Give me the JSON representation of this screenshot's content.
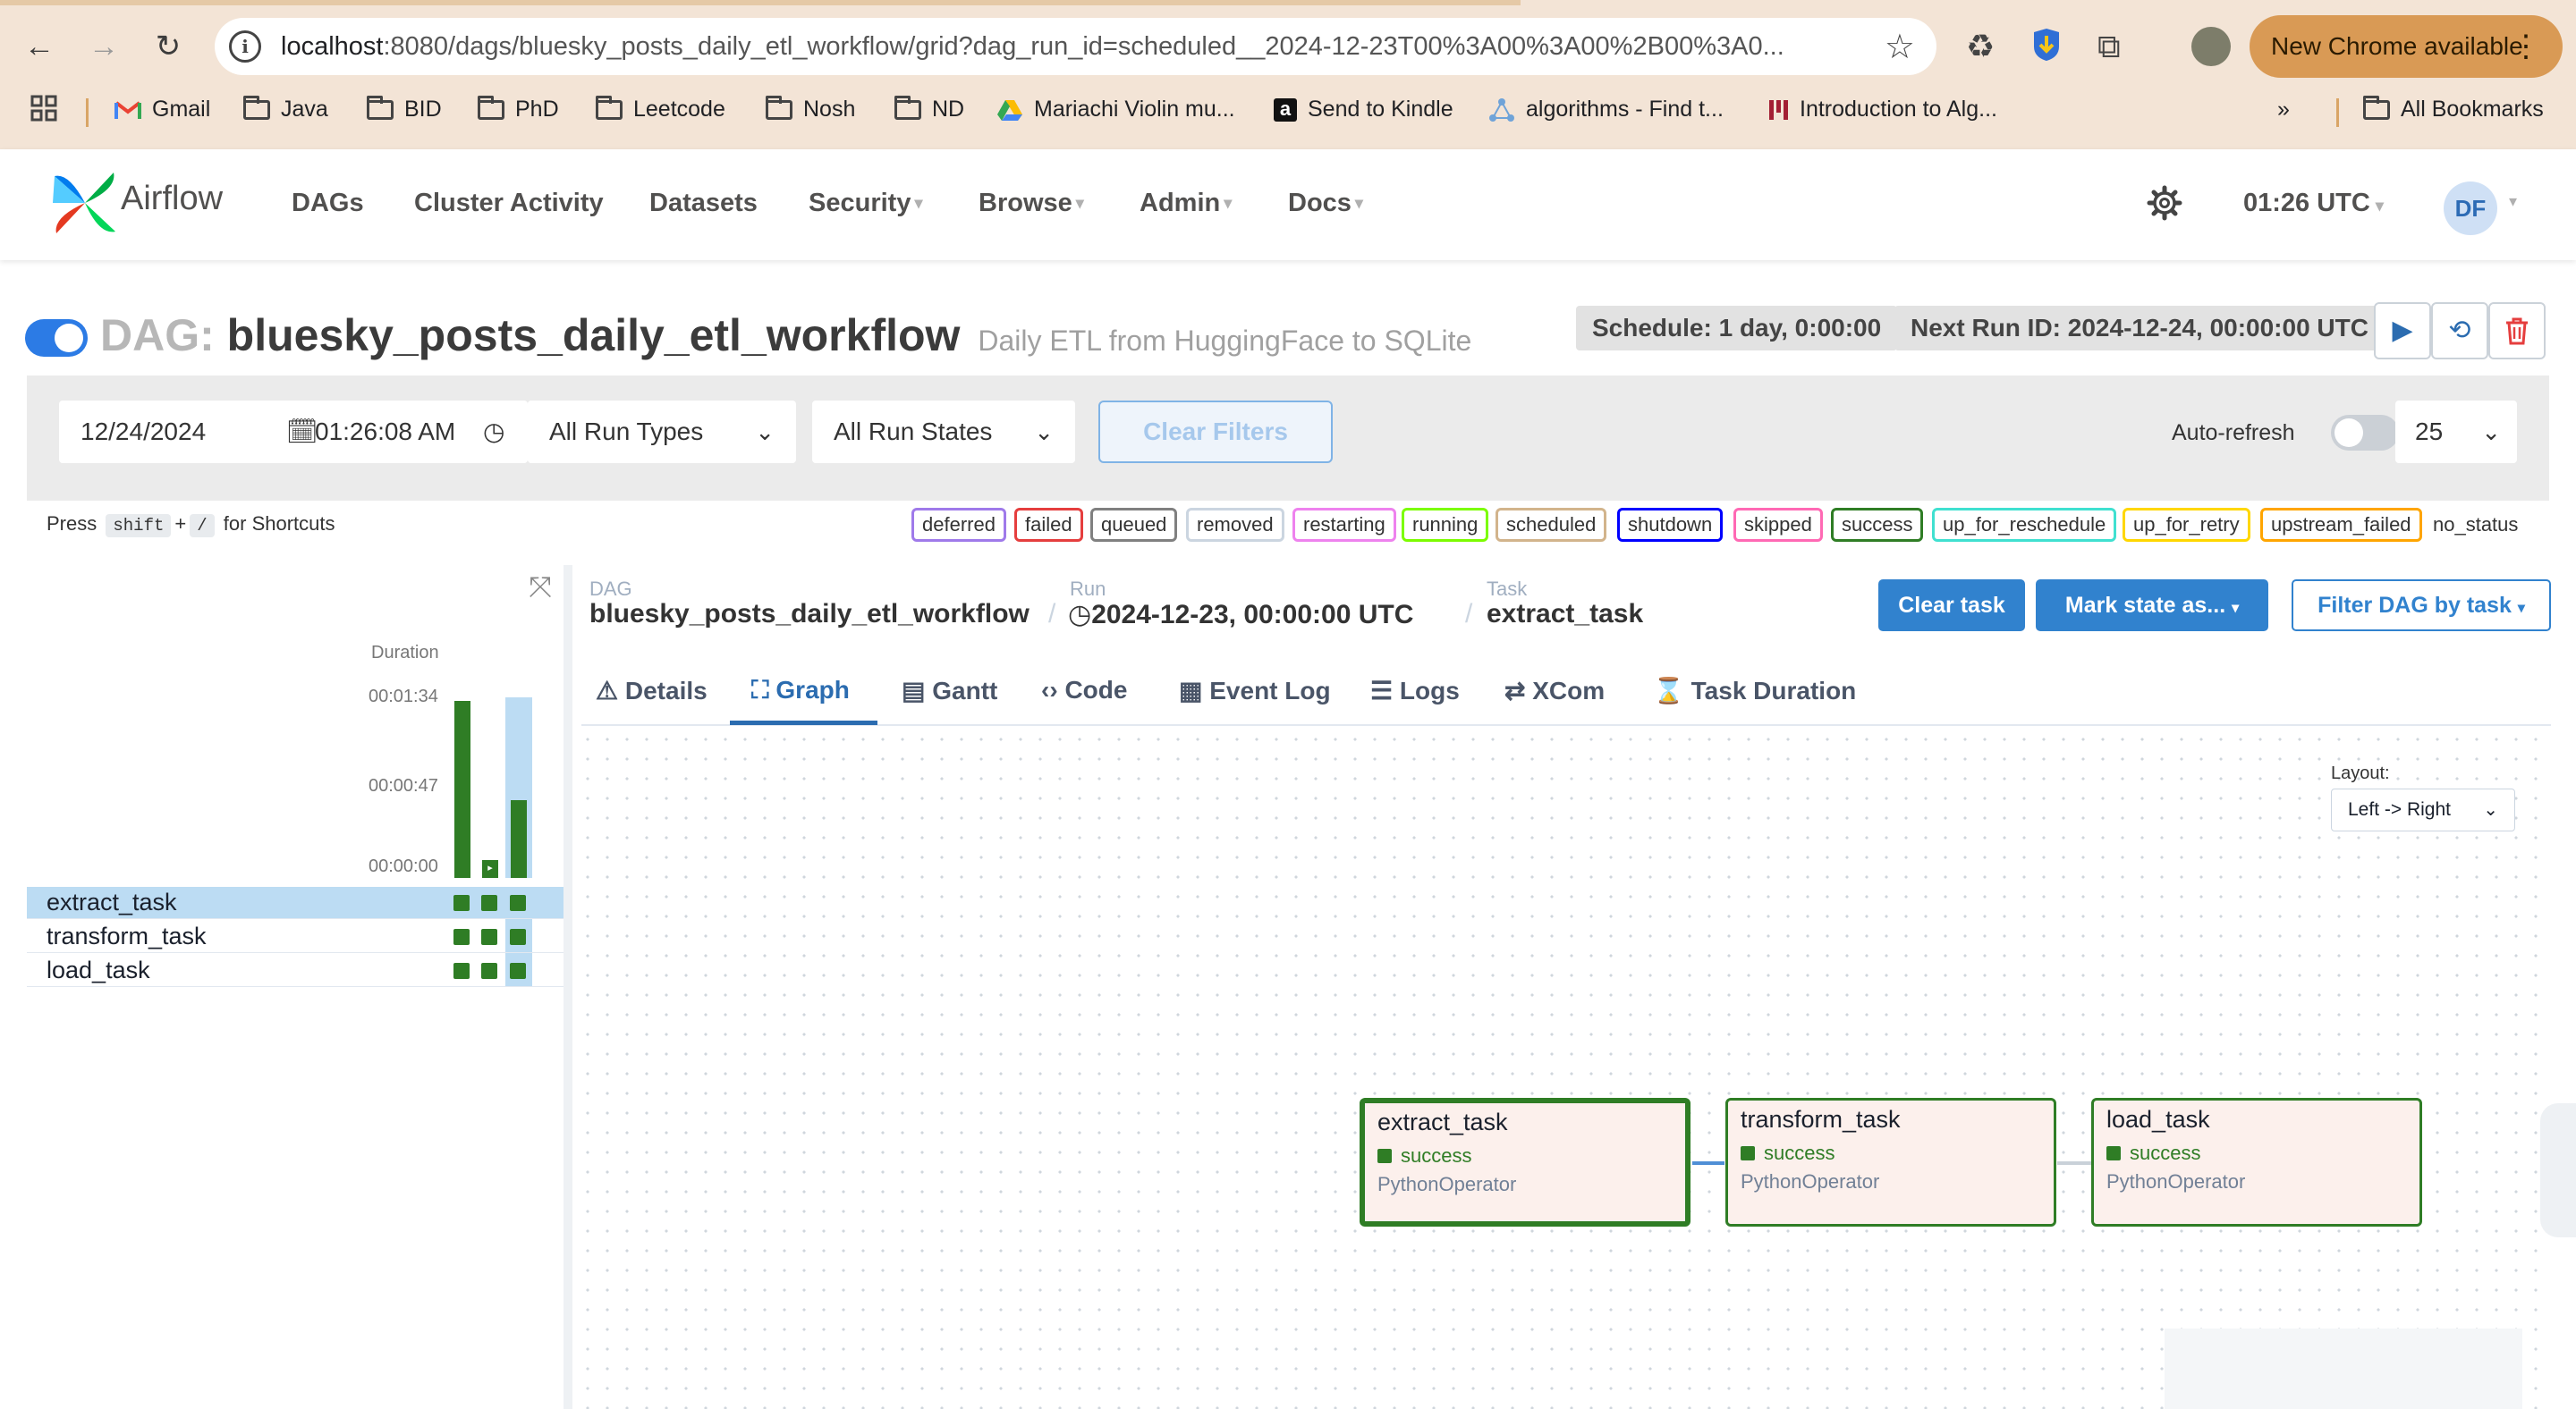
{
  "browser": {
    "url_host": "localhost",
    "url_rest": ":8080/dags/bluesky_posts_daily_etl_workflow/grid?dag_run_id=scheduled__2024-12-23T00%3A00%3A00%2B00%3A0...",
    "new_chrome_label": "New Chrome available",
    "bookmarks": [
      {
        "label": "Gmail",
        "icon": "gmail-icon"
      },
      {
        "label": "Java",
        "icon": "folder-icon"
      },
      {
        "label": "BID",
        "icon": "folder-icon"
      },
      {
        "label": "PhD",
        "icon": "folder-icon"
      },
      {
        "label": "Leetcode",
        "icon": "folder-icon"
      },
      {
        "label": "Nosh",
        "icon": "folder-icon"
      },
      {
        "label": "ND",
        "icon": "folder-icon"
      },
      {
        "label": "Mariachi Violin mu...",
        "icon": "drive-icon"
      },
      {
        "label": "Send to Kindle",
        "icon": "amazon-icon"
      },
      {
        "label": "algorithms - Find t...",
        "icon": "site-icon"
      },
      {
        "label": "Introduction to Alg...",
        "icon": "site-icon"
      }
    ],
    "all_bookmarks": "All Bookmarks"
  },
  "airflow": {
    "brand": "Airflow",
    "menu": [
      {
        "label": "DAGs",
        "dropdown": false
      },
      {
        "label": "Cluster Activity",
        "dropdown": false
      },
      {
        "label": "Datasets",
        "dropdown": false
      },
      {
        "label": "Security",
        "dropdown": true
      },
      {
        "label": "Browse",
        "dropdown": true
      },
      {
        "label": "Admin",
        "dropdown": true
      },
      {
        "label": "Docs",
        "dropdown": true
      }
    ],
    "time": "01:26 UTC",
    "user_initials": "DF"
  },
  "dag": {
    "prefix": "DAG:",
    "name": "bluesky_posts_daily_etl_workflow",
    "description": "Daily ETL from HuggingFace to SQLite",
    "schedule": "Schedule: 1 day, 0:00:00",
    "next_run": "Next Run ID: 2024-12-24, 00:00:00 UTC"
  },
  "filters": {
    "date": "12/24/2024",
    "time": "01:26:08  AM",
    "run_types": "All Run Types",
    "run_states": "All Run States",
    "clear_filters": "Clear Filters",
    "auto_refresh": "Auto-refresh",
    "page_size": "25"
  },
  "shortcuts": {
    "press": "Press",
    "key1": "shift",
    "plus": "+",
    "key2": "/",
    "suffix": "for Shortcuts"
  },
  "legend": [
    {
      "label": "deferred",
      "color": "#9f7aea"
    },
    {
      "label": "failed",
      "color": "#e53e3e"
    },
    {
      "label": "queued",
      "color": "#808080"
    },
    {
      "label": "removed",
      "color": "#cbd5e0"
    },
    {
      "label": "restarting",
      "color": "#ee82ee"
    },
    {
      "label": "running",
      "color": "#7cfc00"
    },
    {
      "label": "scheduled",
      "color": "#d2b48c"
    },
    {
      "label": "shutdown",
      "color": "#0000ff"
    },
    {
      "label": "skipped",
      "color": "#ff69b4"
    },
    {
      "label": "success",
      "color": "#2f7d25"
    },
    {
      "label": "up_for_reschedule",
      "color": "#40e0d0"
    },
    {
      "label": "up_for_retry",
      "color": "#ffd700"
    },
    {
      "label": "upstream_failed",
      "color": "#ffa500"
    }
  ],
  "no_status": "no_status",
  "grid": {
    "duration_label": "Duration",
    "ticks": [
      "00:01:34",
      "00:00:47",
      "00:00:00"
    ],
    "runs": [
      {
        "duration_fraction": 1.0
      },
      {
        "duration_fraction": 0.1
      },
      {
        "duration_fraction": 0.44
      }
    ],
    "tasks": [
      "extract_task",
      "transform_task",
      "load_task"
    ],
    "selected_task": "extract_task"
  },
  "details": {
    "dag_label": "DAG",
    "dag_value": "bluesky_posts_daily_etl_workflow",
    "run_label": "Run",
    "run_value": "2024-12-23, 00:00:00 UTC",
    "task_label": "Task",
    "task_value": "extract_task",
    "clear_task": "Clear task",
    "mark_state": "Mark state as...",
    "filter_dag": "Filter DAG by task",
    "tabs": [
      "Details",
      "Graph",
      "Gantt",
      "Code",
      "Event Log",
      "Logs",
      "XCom",
      "Task Duration"
    ],
    "active_tab": "Graph",
    "layout_label": "Layout:",
    "layout_value": "Left -> Right"
  },
  "graph": {
    "nodes": [
      {
        "name": "extract_task",
        "state": "success",
        "operator": "PythonOperator"
      },
      {
        "name": "transform_task",
        "state": "success",
        "operator": "PythonOperator"
      },
      {
        "name": "load_task",
        "state": "success",
        "operator": "PythonOperator"
      }
    ]
  }
}
